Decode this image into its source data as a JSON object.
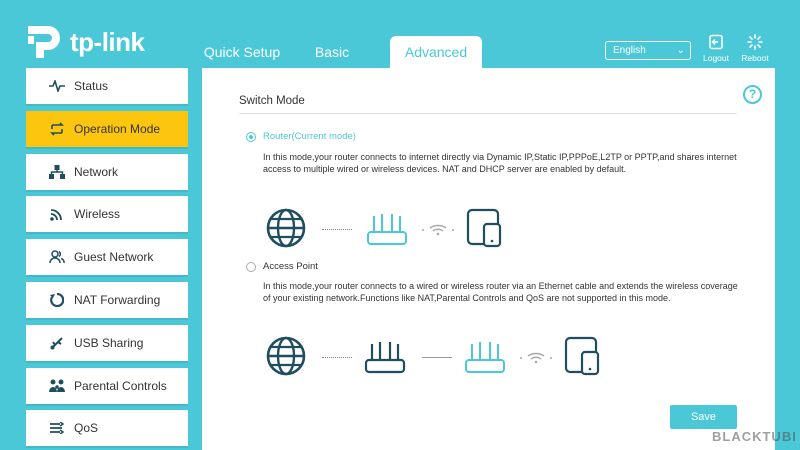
{
  "brand": {
    "name": "tp-link"
  },
  "tabs": [
    {
      "label": "Quick Setup"
    },
    {
      "label": "Basic"
    },
    {
      "label": "Advanced"
    }
  ],
  "language": {
    "selected": "English"
  },
  "header_buttons": {
    "logout": "Logout",
    "reboot": "Reboot"
  },
  "sidebar": {
    "items": [
      {
        "label": "Status",
        "icon": "pulse-icon"
      },
      {
        "label": "Operation Mode",
        "icon": "swap-icon"
      },
      {
        "label": "Network",
        "icon": "network-icon"
      },
      {
        "label": "Wireless",
        "icon": "wireless-icon"
      },
      {
        "label": "Guest Network",
        "icon": "guest-icon"
      },
      {
        "label": "NAT Forwarding",
        "icon": "nat-icon"
      },
      {
        "label": "USB Sharing",
        "icon": "usb-icon"
      },
      {
        "label": "Parental Controls",
        "icon": "parental-icon"
      },
      {
        "label": "QoS",
        "icon": "qos-icon"
      }
    ],
    "active_index": 1
  },
  "main": {
    "title": "Switch Mode",
    "help_symbol": "?",
    "router": {
      "label": "Router(Current mode)",
      "checked": true,
      "description": "In this mode,your router connects to internet directly via Dynamic IP,Static IP,PPPoE,L2TP or PPTP,and shares internet access to multiple wired or wireless devices. NAT and DHCP server are enabled by default."
    },
    "access_point": {
      "label": "Access Point",
      "checked": false,
      "description": "In this mode,your router connects to a wired or wireless router via an Ethernet cable and extends the wireless coverage of your existing network.Functions like NAT,Parental Controls and QoS are not supported in this mode."
    },
    "save_label": "Save"
  },
  "colors": {
    "accent": "#4ac8d8",
    "active": "#fcc50e",
    "icon_dark": "#1f4e5f"
  },
  "watermark": "BLACKTUBI"
}
